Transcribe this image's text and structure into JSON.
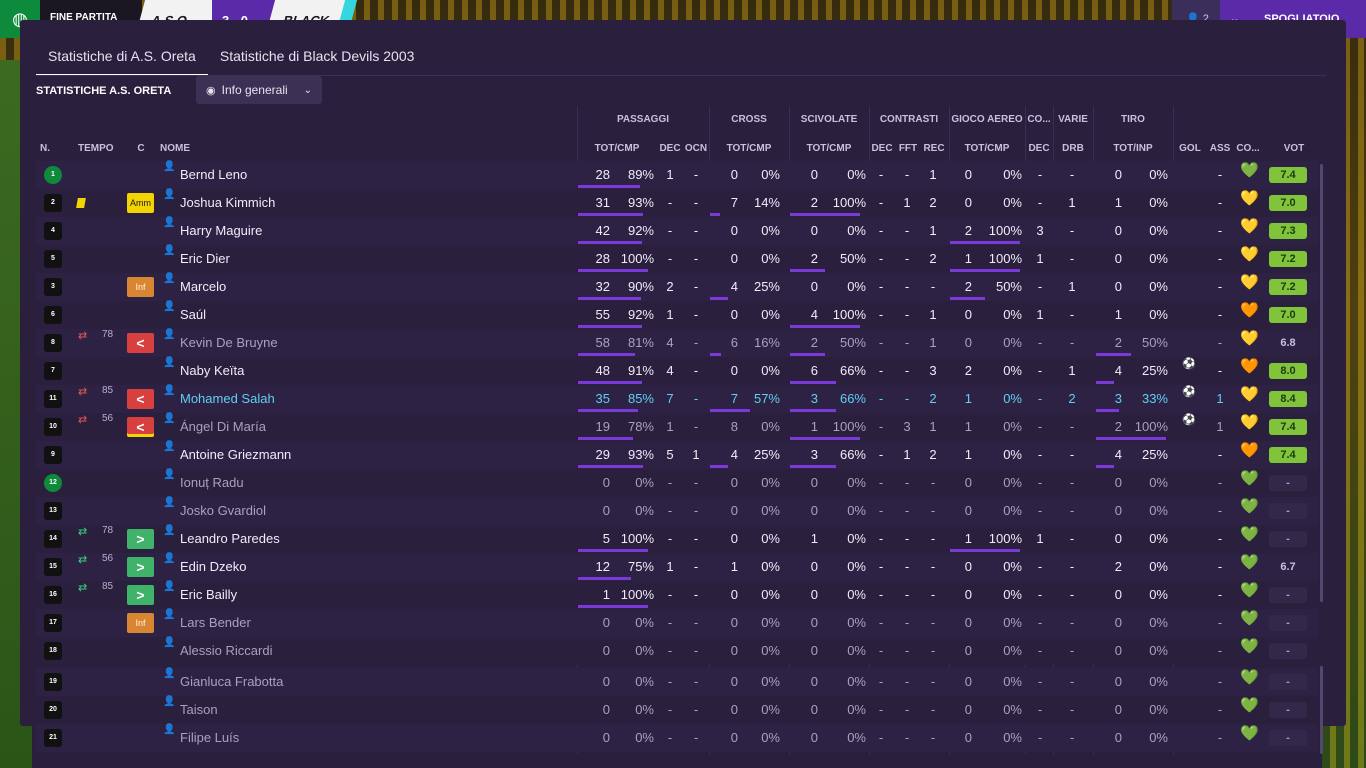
{
  "topbar": {
    "status": "FINE PARTITA",
    "home": "A.S.O",
    "score": "3 - 0",
    "away": "BLACK",
    "right_count": "👤 2",
    "right_chevron": "⌄",
    "right_button": "SPOGLIATOIO"
  },
  "tabs": [
    {
      "label": "Statistiche di A.S. Oreta",
      "active": true
    },
    {
      "label": "Statistiche di Black Devils 2003",
      "active": false
    }
  ],
  "section_title": "STATISTICHE A.S. ORETA",
  "view_dropdown": "Info generali",
  "group_headers": {
    "passaggi": "PASSAGGI",
    "cross": "CROSS",
    "scivolate": "SCIVOLATE",
    "contrasti": "CONTRASTI",
    "gioco_aereo": "GIOCO AEREO",
    "co": "CO...",
    "varie": "VARIE",
    "tiro": "TIRO"
  },
  "columns": {
    "n": "N.",
    "tempo": "TEMPO",
    "c": "C",
    "nome": "NOME",
    "pass_totcmp": "TOT/CMP",
    "dec": "DEC",
    "ocn": "OCN",
    "cross_totcmp": "TOT/CMP",
    "sciv_totcmp": "TOT/CMP",
    "con_dec": "DEC",
    "fft": "FFT",
    "rec": "REC",
    "aereo_totcmp": "TOT/CMP",
    "co_dec": "DEC",
    "drb": "DRB",
    "tiro_totinp": "TOT/INP",
    "gol": "GOL",
    "ass": "ASS",
    "co2": "CO...",
    "vot": "VOT"
  },
  "players": [
    {
      "n": "1",
      "gk": true,
      "name": "Bernd Leno",
      "pass": "28",
      "pass_pct": "89%",
      "pass_frac": 0.89,
      "dec": "1",
      "ocn": "-",
      "cross": "0",
      "cross_pct": "0%",
      "cross_frac": 0,
      "sciv": "0",
      "sciv_pct": "0%",
      "sciv_frac": 0,
      "cdec": "-",
      "fft": "-",
      "rec": "1",
      "aer": "0",
      "aer_pct": "0%",
      "aer_frac": 0,
      "codec": "-",
      "drb": "-",
      "tiro": "0",
      "tiro_pct": "0%",
      "tiro_frac": 0,
      "gol": "",
      "ass": "-",
      "mood": "heart",
      "vot": "7.4",
      "vot_style": "good"
    },
    {
      "n": "2",
      "card": "yellow",
      "badge": "Amm",
      "badge_type": "amm",
      "name": "Joshua Kimmich",
      "pass": "31",
      "pass_pct": "93%",
      "pass_frac": 0.93,
      "dec": "-",
      "ocn": "-",
      "cross": "7",
      "cross_pct": "14%",
      "cross_frac": 0.14,
      "sciv": "2",
      "sciv_pct": "100%",
      "sciv_frac": 1,
      "cdec": "-",
      "fft": "1",
      "rec": "2",
      "aer": "0",
      "aer_pct": "0%",
      "aer_frac": 0,
      "codec": "-",
      "drb": "1",
      "tiro": "1",
      "tiro_pct": "0%",
      "tiro_frac": 0,
      "gol": "",
      "ass": "-",
      "mood": "happy",
      "vot": "7.0",
      "vot_style": "good"
    },
    {
      "n": "4",
      "name": "Harry Maguire",
      "pass": "42",
      "pass_pct": "92%",
      "pass_frac": 0.92,
      "dec": "-",
      "ocn": "-",
      "cross": "0",
      "cross_pct": "0%",
      "cross_frac": 0,
      "sciv": "0",
      "sciv_pct": "0%",
      "sciv_frac": 0,
      "cdec": "-",
      "fft": "-",
      "rec": "1",
      "aer": "2",
      "aer_pct": "100%",
      "aer_frac": 1,
      "codec": "3",
      "drb": "-",
      "tiro": "0",
      "tiro_pct": "0%",
      "tiro_frac": 0,
      "gol": "",
      "ass": "-",
      "mood": "happy",
      "vot": "7.3",
      "vot_style": "good"
    },
    {
      "n": "5",
      "name": "Eric Dier",
      "pass": "28",
      "pass_pct": "100%",
      "pass_frac": 1,
      "dec": "-",
      "ocn": "-",
      "cross": "0",
      "cross_pct": "0%",
      "cross_frac": 0,
      "sciv": "2",
      "sciv_pct": "50%",
      "sciv_frac": 0.5,
      "cdec": "-",
      "fft": "-",
      "rec": "2",
      "aer": "1",
      "aer_pct": "100%",
      "aer_frac": 1,
      "codec": "1",
      "drb": "-",
      "tiro": "0",
      "tiro_pct": "0%",
      "tiro_frac": 0,
      "gol": "",
      "ass": "-",
      "mood": "happy",
      "vot": "7.2",
      "vot_style": "good"
    },
    {
      "n": "3",
      "badge": "Inf",
      "badge_type": "inf",
      "name": "Marcelo",
      "pass": "32",
      "pass_pct": "90%",
      "pass_frac": 0.9,
      "dec": "2",
      "ocn": "-",
      "cross": "4",
      "cross_pct": "25%",
      "cross_frac": 0.25,
      "sciv": "0",
      "sciv_pct": "0%",
      "sciv_frac": 0,
      "cdec": "-",
      "fft": "-",
      "rec": "-",
      "aer": "2",
      "aer_pct": "50%",
      "aer_frac": 0.5,
      "codec": "-",
      "drb": "1",
      "tiro": "0",
      "tiro_pct": "0%",
      "tiro_frac": 0,
      "gol": "",
      "ass": "-",
      "mood": "happy",
      "vot": "7.2",
      "vot_style": "good"
    },
    {
      "n": "6",
      "name": "Saúl",
      "pass": "55",
      "pass_pct": "92%",
      "pass_frac": 0.92,
      "dec": "1",
      "ocn": "-",
      "cross": "0",
      "cross_pct": "0%",
      "cross_frac": 0,
      "sciv": "4",
      "sciv_pct": "100%",
      "sciv_frac": 1,
      "cdec": "-",
      "fft": "-",
      "rec": "1",
      "aer": "0",
      "aer_pct": "0%",
      "aer_frac": 0,
      "codec": "1",
      "drb": "-",
      "tiro": "1",
      "tiro_pct": "0%",
      "tiro_frac": 0,
      "gol": "",
      "ass": "-",
      "mood": "ok",
      "vot": "7.0",
      "vot_style": "good"
    },
    {
      "n": "8",
      "dim": true,
      "swap": "out",
      "minute": "78",
      "badge": "<",
      "badge_type": "out",
      "name": "Kevin De Bruyne",
      "pass": "58",
      "pass_pct": "81%",
      "pass_frac": 0.81,
      "dec": "4",
      "ocn": "-",
      "cross": "6",
      "cross_pct": "16%",
      "cross_frac": 0.16,
      "sciv": "2",
      "sciv_pct": "50%",
      "sciv_frac": 0.5,
      "cdec": "-",
      "fft": "-",
      "rec": "1",
      "aer": "0",
      "aer_pct": "0%",
      "aer_frac": 0,
      "codec": "-",
      "drb": "-",
      "tiro": "2",
      "tiro_pct": "50%",
      "tiro_frac": 0.5,
      "gol": "",
      "ass": "-",
      "mood": "happy",
      "vot": "6.8",
      "vot_style": "plain"
    },
    {
      "n": "7",
      "name": "Naby Keïta",
      "pass": "48",
      "pass_pct": "91%",
      "pass_frac": 0.91,
      "dec": "4",
      "ocn": "-",
      "cross": "0",
      "cross_pct": "0%",
      "cross_frac": 0,
      "sciv": "6",
      "sciv_pct": "66%",
      "sciv_frac": 0.66,
      "cdec": "-",
      "fft": "-",
      "rec": "3",
      "aer": "2",
      "aer_pct": "0%",
      "aer_frac": 0,
      "codec": "-",
      "drb": "1",
      "tiro": "4",
      "tiro_pct": "25%",
      "tiro_frac": 0.25,
      "gol": "⚽",
      "ass": "-",
      "mood": "ok",
      "vot": "8.0",
      "vot_style": "good"
    },
    {
      "n": "11",
      "sel": true,
      "swap": "out",
      "minute": "85",
      "badge": "<",
      "badge_type": "out",
      "name": "Mohamed Salah",
      "pass": "35",
      "pass_pct": "85%",
      "pass_frac": 0.85,
      "dec": "7",
      "ocn": "-",
      "cross": "7",
      "cross_pct": "57%",
      "cross_frac": 0.57,
      "sciv": "3",
      "sciv_pct": "66%",
      "sciv_frac": 0.66,
      "cdec": "-",
      "fft": "-",
      "rec": "2",
      "aer": "1",
      "aer_pct": "0%",
      "aer_frac": 0,
      "codec": "-",
      "drb": "2",
      "tiro": "3",
      "tiro_pct": "33%",
      "tiro_frac": 0.33,
      "gol": "⚽",
      "ass": "1",
      "mood": "happy",
      "vot": "8.4",
      "vot_style": "good"
    },
    {
      "n": "10",
      "dim": true,
      "swap": "out",
      "minute": "56",
      "badge": "<",
      "badge_type": "out-yel",
      "name": "Ángel Di María",
      "pass": "19",
      "pass_pct": "78%",
      "pass_frac": 0.78,
      "dec": "1",
      "ocn": "-",
      "cross": "8",
      "cross_pct": "0%",
      "cross_frac": 0,
      "sciv": "1",
      "sciv_pct": "100%",
      "sciv_frac": 1,
      "cdec": "-",
      "fft": "3",
      "rec": "1",
      "aer": "1",
      "aer_pct": "0%",
      "aer_frac": 0,
      "codec": "-",
      "drb": "-",
      "tiro": "2",
      "tiro_pct": "100%",
      "tiro_frac": 1,
      "gol": "⚽",
      "ass": "1",
      "mood": "happy",
      "vot": "7.4",
      "vot_style": "good"
    },
    {
      "n": "9",
      "name": "Antoine Griezmann",
      "pass": "29",
      "pass_pct": "93%",
      "pass_frac": 0.93,
      "dec": "5",
      "ocn": "1",
      "cross": "4",
      "cross_pct": "25%",
      "cross_frac": 0.25,
      "sciv": "3",
      "sciv_pct": "66%",
      "sciv_frac": 0.66,
      "cdec": "-",
      "fft": "1",
      "rec": "2",
      "aer": "1",
      "aer_pct": "0%",
      "aer_frac": 0,
      "codec": "-",
      "drb": "-",
      "tiro": "4",
      "tiro_pct": "25%",
      "tiro_frac": 0.25,
      "gol": "",
      "ass": "-",
      "mood": "ok",
      "vot": "7.4",
      "vot_style": "good"
    },
    {
      "n": "12",
      "gk": true,
      "dim": true,
      "name": "Ionuț Radu",
      "pass": "0",
      "pass_pct": "0%",
      "pass_frac": 0,
      "dec": "-",
      "ocn": "-",
      "cross": "0",
      "cross_pct": "0%",
      "cross_frac": 0,
      "sciv": "0",
      "sciv_pct": "0%",
      "sciv_frac": 0,
      "cdec": "-",
      "fft": "-",
      "rec": "-",
      "aer": "0",
      "aer_pct": "0%",
      "aer_frac": 0,
      "codec": "-",
      "drb": "-",
      "tiro": "0",
      "tiro_pct": "0%",
      "tiro_frac": 0,
      "gol": "",
      "ass": "-",
      "mood": "heart",
      "vot": "-",
      "vot_style": "dash"
    },
    {
      "n": "13",
      "dim": true,
      "name": "Josko Gvardiol",
      "pass": "0",
      "pass_pct": "0%",
      "pass_frac": 0,
      "dec": "-",
      "ocn": "-",
      "cross": "0",
      "cross_pct": "0%",
      "cross_frac": 0,
      "sciv": "0",
      "sciv_pct": "0%",
      "sciv_frac": 0,
      "cdec": "-",
      "fft": "-",
      "rec": "-",
      "aer": "0",
      "aer_pct": "0%",
      "aer_frac": 0,
      "codec": "-",
      "drb": "-",
      "tiro": "0",
      "tiro_pct": "0%",
      "tiro_frac": 0,
      "gol": "",
      "ass": "-",
      "mood": "heart",
      "vot": "-",
      "vot_style": "dash"
    },
    {
      "n": "14",
      "swap": "in",
      "minute": "78",
      "badge": ">",
      "badge_type": "in",
      "name": "Leandro Paredes",
      "pass": "5",
      "pass_pct": "100%",
      "pass_frac": 1,
      "dec": "-",
      "ocn": "-",
      "cross": "0",
      "cross_pct": "0%",
      "cross_frac": 0,
      "sciv": "1",
      "sciv_pct": "0%",
      "sciv_frac": 0,
      "cdec": "-",
      "fft": "-",
      "rec": "-",
      "aer": "1",
      "aer_pct": "100%",
      "aer_frac": 1,
      "codec": "1",
      "drb": "-",
      "tiro": "0",
      "tiro_pct": "0%",
      "tiro_frac": 0,
      "gol": "",
      "ass": "-",
      "mood": "heart",
      "vot": "-",
      "vot_style": "dash"
    },
    {
      "n": "15",
      "swap": "in",
      "minute": "56",
      "badge": ">",
      "badge_type": "in",
      "name": "Edin Dzeko",
      "pass": "12",
      "pass_pct": "75%",
      "pass_frac": 0.75,
      "dec": "1",
      "ocn": "-",
      "cross": "1",
      "cross_pct": "0%",
      "cross_frac": 0,
      "sciv": "0",
      "sciv_pct": "0%",
      "sciv_frac": 0,
      "cdec": "-",
      "fft": "-",
      "rec": "-",
      "aer": "0",
      "aer_pct": "0%",
      "aer_frac": 0,
      "codec": "-",
      "drb": "-",
      "tiro": "2",
      "tiro_pct": "0%",
      "tiro_frac": 0,
      "gol": "",
      "ass": "-",
      "mood": "heart",
      "vot": "6.7",
      "vot_style": "plain"
    },
    {
      "n": "16",
      "swap": "in",
      "minute": "85",
      "badge": ">",
      "badge_type": "in",
      "name": "Eric Bailly",
      "pass": "1",
      "pass_pct": "100%",
      "pass_frac": 1,
      "dec": "-",
      "ocn": "-",
      "cross": "0",
      "cross_pct": "0%",
      "cross_frac": 0,
      "sciv": "0",
      "sciv_pct": "0%",
      "sciv_frac": 0,
      "cdec": "-",
      "fft": "-",
      "rec": "-",
      "aer": "0",
      "aer_pct": "0%",
      "aer_frac": 0,
      "codec": "-",
      "drb": "-",
      "tiro": "0",
      "tiro_pct": "0%",
      "tiro_frac": 0,
      "gol": "",
      "ass": "-",
      "mood": "heart",
      "vot": "-",
      "vot_style": "dash"
    },
    {
      "n": "17",
      "dim": true,
      "badge": "Inf",
      "badge_type": "inf",
      "name": "Lars Bender",
      "pass": "0",
      "pass_pct": "0%",
      "pass_frac": 0,
      "dec": "-",
      "ocn": "-",
      "cross": "0",
      "cross_pct": "0%",
      "cross_frac": 0,
      "sciv": "0",
      "sciv_pct": "0%",
      "sciv_frac": 0,
      "cdec": "-",
      "fft": "-",
      "rec": "-",
      "aer": "0",
      "aer_pct": "0%",
      "aer_frac": 0,
      "codec": "-",
      "drb": "-",
      "tiro": "0",
      "tiro_pct": "0%",
      "tiro_frac": 0,
      "gol": "",
      "ass": "-",
      "mood": "heart",
      "vot": "-",
      "vot_style": "dash"
    },
    {
      "n": "18",
      "dim": true,
      "name": "Alessio Riccardi",
      "pass": "0",
      "pass_pct": "0%",
      "pass_frac": 0,
      "dec": "-",
      "ocn": "-",
      "cross": "0",
      "cross_pct": "0%",
      "cross_frac": 0,
      "sciv": "0",
      "sciv_pct": "0%",
      "sciv_frac": 0,
      "cdec": "-",
      "fft": "-",
      "rec": "-",
      "aer": "0",
      "aer_pct": "0%",
      "aer_frac": 0,
      "codec": "-",
      "drb": "-",
      "tiro": "0",
      "tiro_pct": "0%",
      "tiro_frac": 0,
      "gol": "",
      "ass": "-",
      "mood": "heart",
      "vot": "-",
      "vot_style": "dash"
    },
    {
      "n": "19",
      "dim": true,
      "name": "Gianluca Frabotta",
      "pass": "0",
      "pass_pct": "0%",
      "pass_frac": 0,
      "dec": "-",
      "ocn": "-",
      "cross": "0",
      "cross_pct": "0%",
      "cross_frac": 0,
      "sciv": "0",
      "sciv_pct": "0%",
      "sciv_frac": 0,
      "cdec": "-",
      "fft": "-",
      "rec": "-",
      "aer": "0",
      "aer_pct": "0%",
      "aer_frac": 0,
      "codec": "-",
      "drb": "-",
      "tiro": "0",
      "tiro_pct": "0%",
      "tiro_frac": 0,
      "gol": "",
      "ass": "-",
      "mood": "heart",
      "vot": "-",
      "vot_style": "dash"
    },
    {
      "n": "20",
      "dim": true,
      "name": "Taison",
      "pass": "0",
      "pass_pct": "0%",
      "pass_frac": 0,
      "dec": "-",
      "ocn": "-",
      "cross": "0",
      "cross_pct": "0%",
      "cross_frac": 0,
      "sciv": "0",
      "sciv_pct": "0%",
      "sciv_frac": 0,
      "cdec": "-",
      "fft": "-",
      "rec": "-",
      "aer": "0",
      "aer_pct": "0%",
      "aer_frac": 0,
      "codec": "-",
      "drb": "-",
      "tiro": "0",
      "tiro_pct": "0%",
      "tiro_frac": 0,
      "gol": "",
      "ass": "-",
      "mood": "heart",
      "vot": "-",
      "vot_style": "dash"
    },
    {
      "n": "21",
      "dim": true,
      "name": "Filipe Luís",
      "pass": "0",
      "pass_pct": "0%",
      "pass_frac": 0,
      "dec": "-",
      "ocn": "-",
      "cross": "0",
      "cross_pct": "0%",
      "cross_frac": 0,
      "sciv": "0",
      "sciv_pct": "0%",
      "sciv_frac": 0,
      "cdec": "-",
      "fft": "-",
      "rec": "-",
      "aer": "0",
      "aer_pct": "0%",
      "aer_frac": 0,
      "codec": "-",
      "drb": "-",
      "tiro": "0",
      "tiro_pct": "0%",
      "tiro_frac": 0,
      "gol": "",
      "ass": "-",
      "mood": "heart",
      "vot": "-",
      "vot_style": "dash"
    }
  ]
}
